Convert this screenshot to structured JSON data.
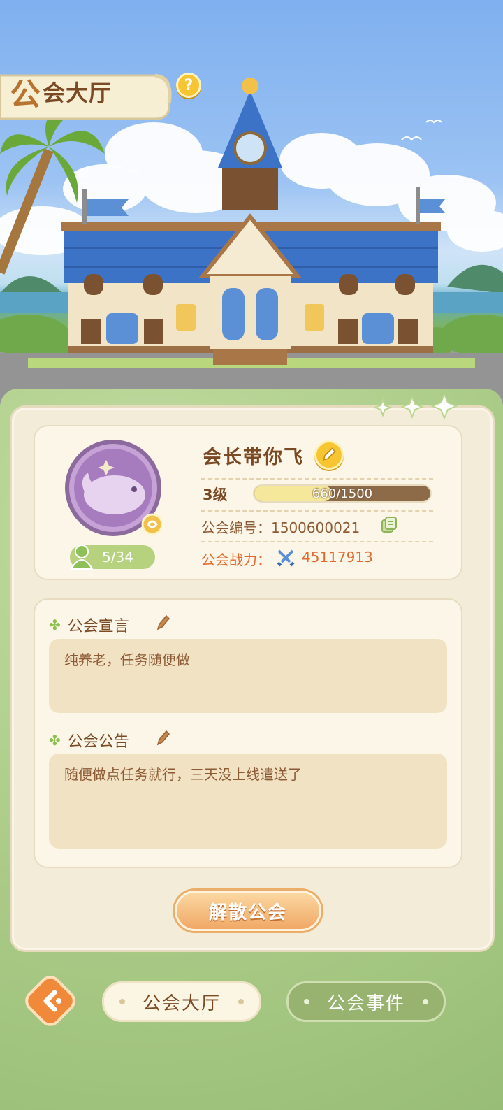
{
  "header": {
    "title_first_char": "公",
    "title_rest": "会大厅",
    "help_label": "?"
  },
  "guild": {
    "name": "会长带你飞",
    "level": "3级",
    "exp_text": "660/1500",
    "exp_fraction": 0.44,
    "id_label": "公会编号：1500600021",
    "power_label": "公会战力：",
    "power_value": "45117913",
    "members": "5/34"
  },
  "declaration": {
    "title": "公会宣言",
    "text": "纯养老，任务随便做"
  },
  "announcement": {
    "title": "公会公告",
    "text": "随便做点任务就行，三天没上线遣送了"
  },
  "actions": {
    "dissolve_label": "解散公会"
  },
  "nav": {
    "tabs": [
      {
        "label": "公会大厅",
        "active": true
      },
      {
        "label": "公会事件",
        "active": false
      }
    ]
  },
  "icons": {
    "help": "question-icon",
    "edit": "pencil-icon",
    "copy": "copy-icon",
    "power": "crossed-swords-icon",
    "members": "members-icon",
    "back": "back-arrow-icon"
  },
  "colors": {
    "accent_orange": "#e06a2c",
    "text_brown": "#7a4a24",
    "panel_cream": "#f3ecd9",
    "green_bg": "#a9c98a"
  }
}
